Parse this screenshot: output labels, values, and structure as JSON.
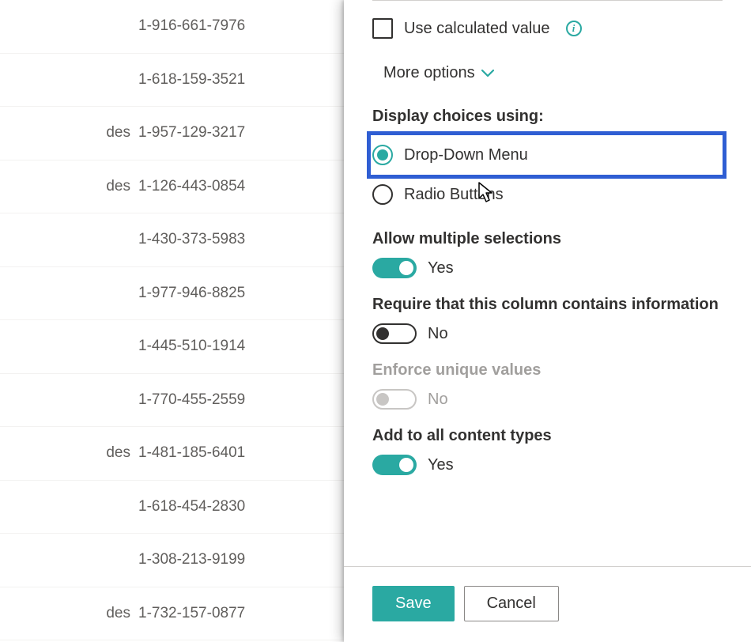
{
  "list": {
    "rows": [
      {
        "left": "",
        "phone": "1-916-661-7976"
      },
      {
        "left": "",
        "phone": "1-618-159-3521"
      },
      {
        "left": "des",
        "phone": "1-957-129-3217"
      },
      {
        "left": "des",
        "phone": "1-126-443-0854"
      },
      {
        "left": "",
        "phone": "1-430-373-5983"
      },
      {
        "left": "",
        "phone": "1-977-946-8825"
      },
      {
        "left": "",
        "phone": "1-445-510-1914"
      },
      {
        "left": "",
        "phone": "1-770-455-2559"
      },
      {
        "left": "des",
        "phone": "1-481-185-6401"
      },
      {
        "left": "",
        "phone": "1-618-454-2830"
      },
      {
        "left": "",
        "phone": "1-308-213-9199"
      },
      {
        "left": "des",
        "phone": "1-732-157-0877"
      }
    ]
  },
  "panel": {
    "use_calculated_label": "Use calculated value",
    "more_options_label": "More options",
    "display_choices_title": "Display choices using:",
    "radio_options": {
      "dropdown": "Drop-Down Menu",
      "radio": "Radio Buttons"
    },
    "allow_multiple": {
      "title": "Allow multiple selections",
      "value": "Yes"
    },
    "require_info": {
      "title": "Require that this column contains information",
      "value": "No"
    },
    "enforce_unique": {
      "title": "Enforce unique values",
      "value": "No"
    },
    "add_content_types": {
      "title": "Add to all content types",
      "value": "Yes"
    },
    "buttons": {
      "save": "Save",
      "cancel": "Cancel"
    }
  }
}
